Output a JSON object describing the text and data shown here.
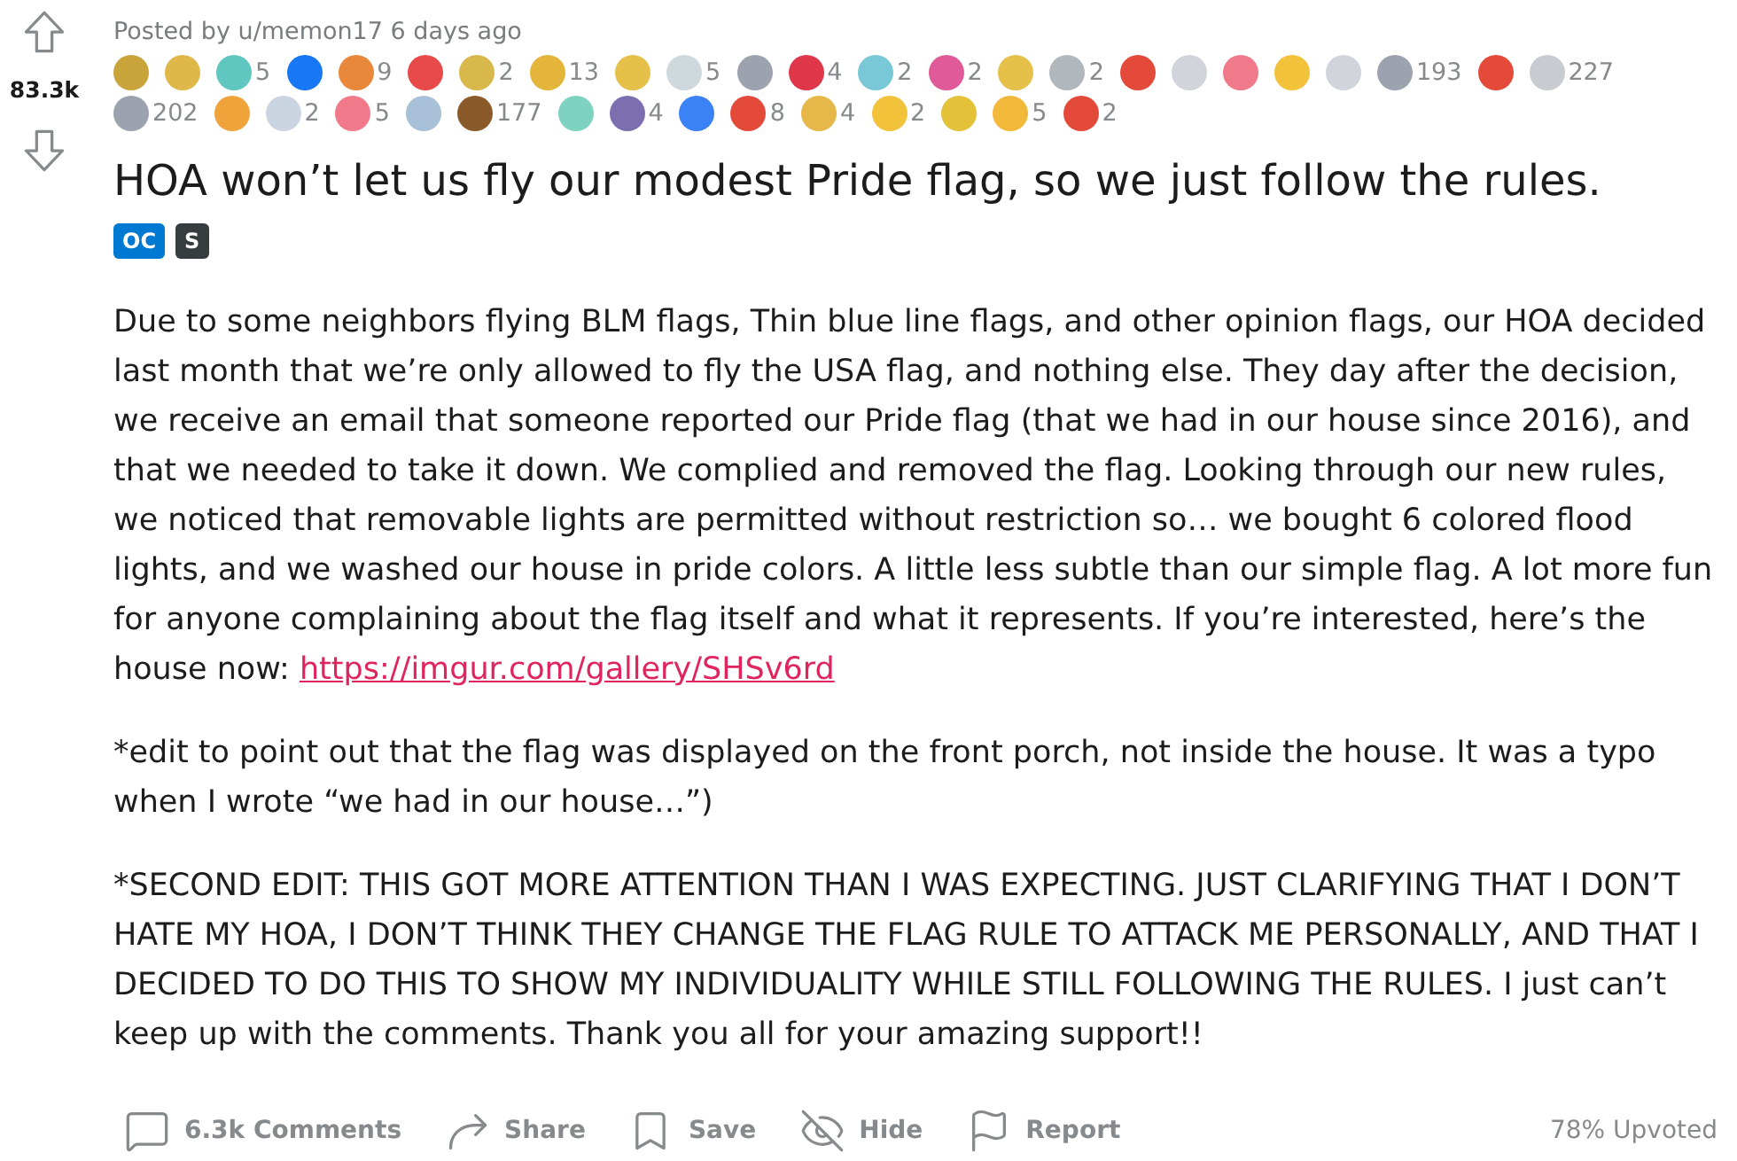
{
  "vote": {
    "score": "83.3k"
  },
  "post": {
    "byline": "Posted by u/memon17 6 days ago",
    "awards": [
      {
        "color": "#c9a43a"
      },
      {
        "color": "#e0b84a"
      },
      {
        "color": "#5fc7c0",
        "count": "5"
      },
      {
        "color": "#1877f2"
      },
      {
        "color": "#e9873a",
        "count": "9"
      },
      {
        "color": "#e84a4a"
      },
      {
        "color": "#d8b84a",
        "count": "2"
      },
      {
        "color": "#e3b53a",
        "count": "13"
      },
      {
        "color": "#e6c14a"
      },
      {
        "color": "#cfd8dc",
        "count": "5"
      },
      {
        "color": "#9ca3af"
      },
      {
        "color": "#e0364a",
        "count": "4"
      },
      {
        "color": "#78c8d8",
        "count": "2"
      },
      {
        "color": "#e05a9a",
        "count": "2"
      },
      {
        "color": "#e6c14a"
      },
      {
        "color": "#b0b7bd",
        "count": "2"
      },
      {
        "color": "#e34a3a"
      },
      {
        "color": "#d1d5db"
      },
      {
        "color": "#f07a8a"
      },
      {
        "color": "#f2c23a"
      },
      {
        "color": "#d1d5db"
      },
      {
        "color": "#9ca3af",
        "count": "193"
      },
      {
        "color": "#e34a3a"
      },
      {
        "color": "#c8ccd0",
        "count": "227"
      },
      {
        "color": "#9ca3af",
        "count": "202"
      },
      {
        "color": "#f0a33a"
      },
      {
        "color": "#cbd5e1",
        "count": "2"
      },
      {
        "color": "#f07a8a",
        "count": "5"
      },
      {
        "color": "#a8c0d8"
      },
      {
        "color": "#8b5a2b",
        "count": "177"
      },
      {
        "color": "#7dd3c0"
      },
      {
        "color": "#7c6fb0",
        "count": "4"
      },
      {
        "color": "#3b82f6"
      },
      {
        "color": "#e34a3a",
        "count": "8"
      },
      {
        "color": "#e6b84a",
        "count": "4"
      },
      {
        "color": "#f2c23a",
        "count": "2"
      },
      {
        "color": "#e3c23a"
      },
      {
        "color": "#f2b83a",
        "count": "5"
      },
      {
        "color": "#e34a3a",
        "count": "2"
      }
    ],
    "title": "HOA won’t let us fly our modest Pride flag, so we just follow the rules.",
    "flairs": [
      {
        "label": "OC",
        "color": "#0079d3"
      },
      {
        "label": "S",
        "color": "#373c3f"
      }
    ],
    "body": [
      {
        "text": "Due to some neighbors flying BLM flags, Thin blue line flags, and other opinion flags, our HOA decided last month that we’re only allowed to fly the USA flag, and nothing else. They day after the decision, we receive an email that someone reported our Pride flag (that we had in our house since 2016), and that we needed to take it down. We complied and removed the flag. Looking through our new rules, we noticed that removable lights are permitted without restriction so… we bought 6 colored flood lights, and we washed our house in pride colors. A little less subtle than our simple flag. A lot more fun for anyone complaining about the flag itself and what it represents. If you’re interested, here’s the house now:",
        "link": "https://imgur.com/gallery/SHSv6rd"
      },
      {
        "text": "*edit to point out that the flag was displayed on the front porch, not inside the house. It was a typo when I wrote “we had in our house…”)"
      },
      {
        "text": "*SECOND EDIT: THIS GOT MORE ATTENTION THAN I WAS EXPECTING. JUST CLARIFYING THAT I DON’T HATE MY HOA, I DON’T THINK THEY CHANGE THE FLAG RULE TO ATTACK ME PERSONALLY, AND THAT I DECIDED TO DO THIS TO SHOW MY INDIVIDUALITY WHILE STILL FOLLOWING THE RULES. I just can’t keep up with the comments. Thank you all for your amazing support!!"
      }
    ]
  },
  "actions": [
    {
      "kind": "comments",
      "label": "6.3k Comments"
    },
    {
      "kind": "share",
      "label": "Share"
    },
    {
      "kind": "save",
      "label": "Save"
    },
    {
      "kind": "hide",
      "label": "Hide"
    },
    {
      "kind": "report",
      "label": "Report"
    }
  ],
  "upvote_ratio": "78% Upvoted"
}
